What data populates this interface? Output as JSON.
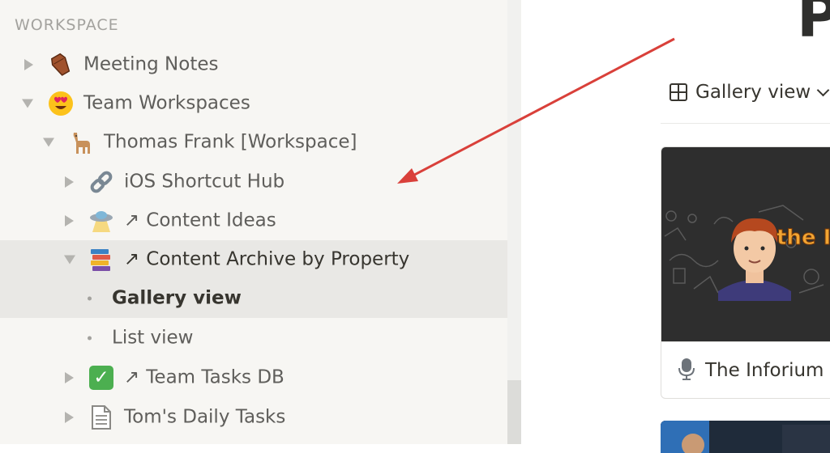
{
  "sidebar": {
    "section_title": "WORKSPACE",
    "items": [
      {
        "label": "Meeting Notes",
        "icon": "coffin-icon"
      },
      {
        "label": "Team Workspaces",
        "icon": "heart-eyes-emoji-icon"
      },
      {
        "label": "Thomas Frank [Workspace]",
        "icon": "llama-icon"
      },
      {
        "label": "iOS Shortcut Hub",
        "icon": "link-icon"
      },
      {
        "label": "Content Ideas",
        "icon": "ufo-icon",
        "link_arrow": "↗"
      },
      {
        "label": "Content Archive by Property",
        "icon": "books-icon",
        "link_arrow": "↗"
      },
      {
        "label": "Gallery view"
      },
      {
        "label": "List view"
      },
      {
        "label": "Team Tasks DB",
        "icon": "checkmark-icon",
        "link_arrow": "↗",
        "check": "✓"
      },
      {
        "label": "Tom's Daily Tasks",
        "icon": "page-icon"
      }
    ]
  },
  "main": {
    "title_fragment": "P",
    "view_switcher": {
      "label": "Gallery view",
      "icon": "grid-icon"
    },
    "card": {
      "title": "The Inforium",
      "icon": "microphone-icon",
      "cover_text": "the INFO"
    }
  },
  "colors": {
    "sidebar_bg": "#f7f6f3",
    "active_row_bg": "#e9e8e5",
    "annotation_arrow": "#d9403a",
    "text": "#37352f",
    "muted_text": "#5f5e5b"
  }
}
